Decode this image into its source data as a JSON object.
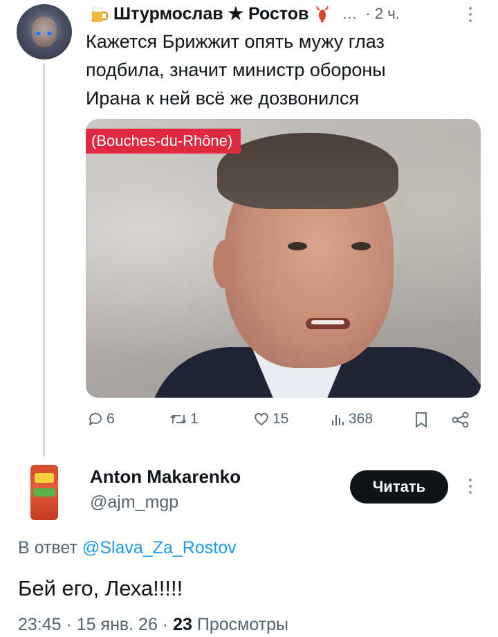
{
  "first_tweet": {
    "author_name": "Штурмослав ★ Ростов",
    "time": "· 2 ч.",
    "text_lines": [
      "Кажется Брижжит опять мужу глаз",
      "подбила, значит министр обороны",
      "Ирана к ней всё же дозвонился"
    ],
    "media_caption": "(Bouches-du-Rhône)",
    "actions": {
      "replies": "6",
      "retweets": "1",
      "likes": "15",
      "views": "368"
    }
  },
  "reply_tweet": {
    "author_name": "Anton Makarenko",
    "handle": "@ajm_mgp",
    "follow_label": "Читать",
    "reply_prefix": "В ответ",
    "reply_to_handle": "@Slava_Za_Rostov",
    "text": "Бей его, Леха!!!!!",
    "time_date": "23:45 · 15 янв. 26 ·",
    "views_count": "23",
    "views_label": "Просмотры"
  },
  "colors": {
    "accent": "#1d9bf0",
    "text": "#0f1419",
    "secondary": "#536471",
    "button": "#0f1419",
    "caption_badge": "#e0283e"
  },
  "icons": [
    "beer-icon",
    "lobster-icon",
    "reply-icon",
    "retweet-icon",
    "like-icon",
    "views-icon",
    "bookmark-icon",
    "share-icon",
    "more-icon"
  ]
}
